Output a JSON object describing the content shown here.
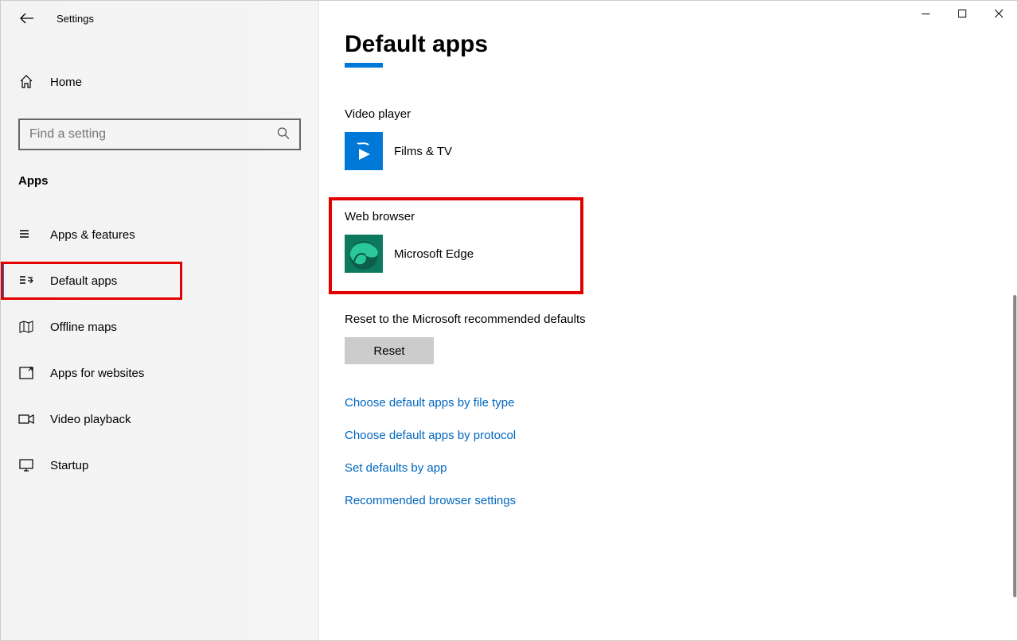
{
  "window": {
    "title": "Settings"
  },
  "sidebar": {
    "home_label": "Home",
    "search_placeholder": "Find a setting",
    "section_label": "Apps",
    "items": [
      {
        "label": "Apps & features",
        "icon": "apps-features"
      },
      {
        "label": "Default apps",
        "icon": "default-apps",
        "active": true
      },
      {
        "label": "Offline maps",
        "icon": "offline-maps"
      },
      {
        "label": "Apps for websites",
        "icon": "apps-websites"
      },
      {
        "label": "Video playback",
        "icon": "video-playback"
      },
      {
        "label": "Startup",
        "icon": "startup"
      }
    ]
  },
  "main": {
    "title": "Default apps",
    "sections": {
      "video_player": {
        "label": "Video player",
        "app_name": "Films & TV"
      },
      "web_browser": {
        "label": "Web browser",
        "app_name": "Microsoft Edge"
      }
    },
    "reset_label": "Reset to the Microsoft recommended defaults",
    "reset_button": "Reset",
    "links": [
      "Choose default apps by file type",
      "Choose default apps by protocol",
      "Set defaults by app",
      "Recommended browser settings"
    ]
  }
}
